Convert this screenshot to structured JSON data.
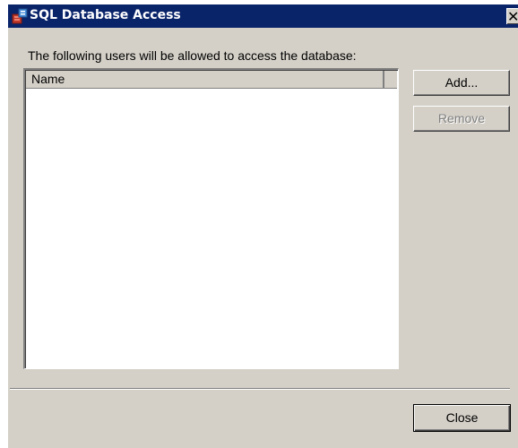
{
  "window": {
    "title": "SQL Database Access",
    "close_glyph": "✕",
    "title_icon": "sql-database-icon",
    "titlebar_color": "#0a246a"
  },
  "main": {
    "description": "The following users will be allowed  to access the database:",
    "list": {
      "columns": [
        "Name"
      ],
      "rows": []
    }
  },
  "buttons": {
    "add_label": "Add...",
    "remove_label": "Remove",
    "close_label": "Close"
  }
}
